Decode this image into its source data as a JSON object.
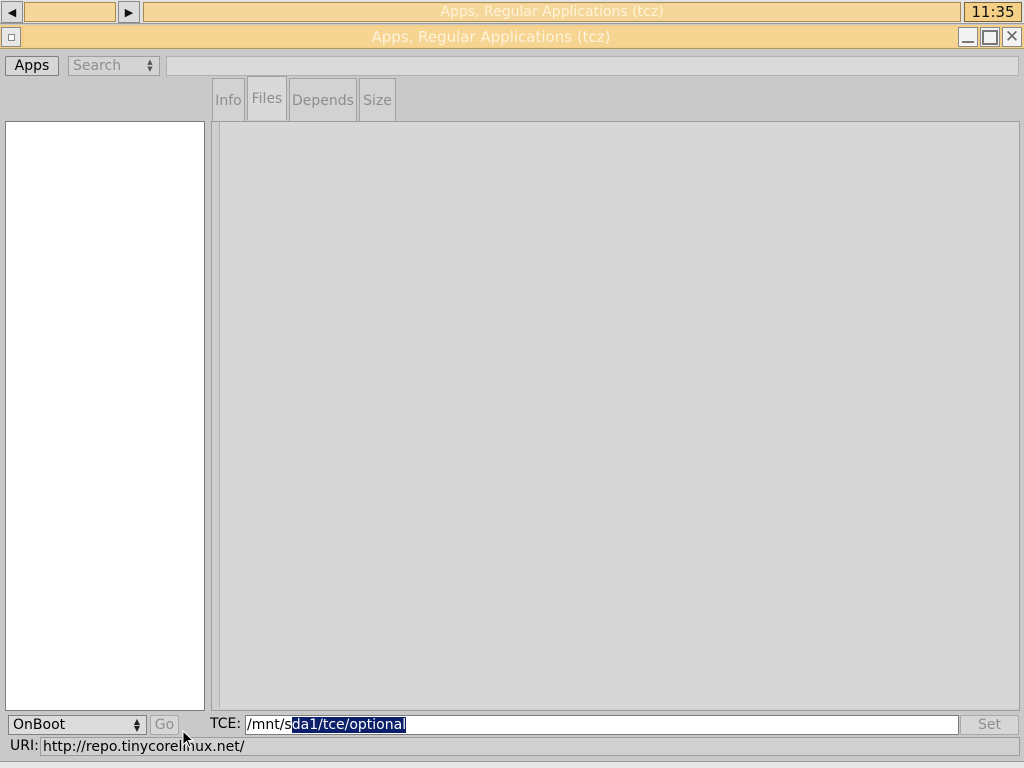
{
  "taskbar": {
    "left_arrow": "◀",
    "right_arrow": "▶",
    "task_title": "Apps, Regular Applications (tcz)",
    "clock": "11:35"
  },
  "window": {
    "title": "Apps, Regular Applications (tcz)"
  },
  "toolbar": {
    "apps_button": "Apps",
    "search_select": "Search",
    "search_value": ""
  },
  "tabs": [
    {
      "label": "Info",
      "active": false
    },
    {
      "label": "Files",
      "active": true
    },
    {
      "label": "Depends",
      "active": false
    },
    {
      "label": "Size",
      "active": false
    }
  ],
  "app_list": [],
  "bottom": {
    "mode_select": "OnBoot",
    "go_button": "Go",
    "tce_label": "TCE:",
    "tce_value_plain": "/mnt/s",
    "tce_value_selected": "da1/tce/optional",
    "set_button": "Set",
    "uri_label": "URI:",
    "uri_value": "http://repo.tinycorelinux.net/"
  },
  "colors": {
    "title_accent": "#f3cf88",
    "selection": "#0b1f6b",
    "background": "#c9c9c9"
  }
}
